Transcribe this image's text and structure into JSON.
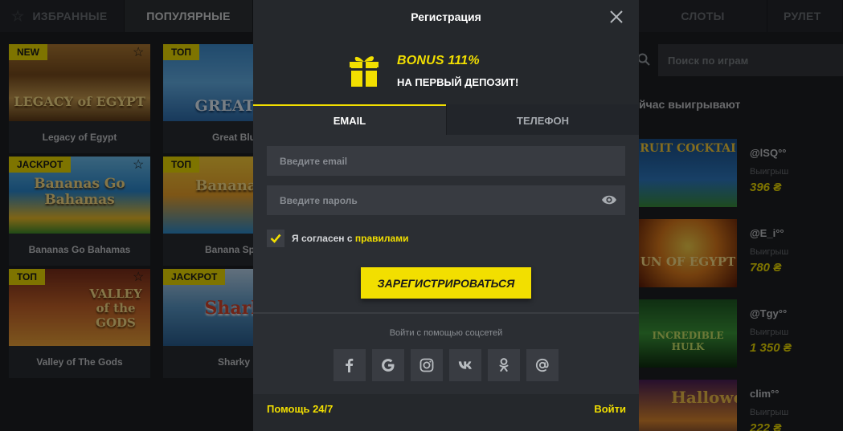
{
  "top_tabs": {
    "favorites": "ИЗБРАННЫЕ",
    "popular": "ПОПУЛЯРНЫЕ",
    "slots": "СЛОТЫ",
    "roulette": "РУЛЕТ"
  },
  "games": [
    {
      "badge": "NEW",
      "name": "Legacy of Egypt",
      "art": "LEGACY of EGYPT"
    },
    {
      "badge": "ТОП",
      "name": "Great Blu",
      "art": "GREAT B"
    },
    {
      "badge": "JACKPOT",
      "name": "Bananas Go Bahamas",
      "art": "Bananas Go Bahamas"
    },
    {
      "badge": "ТОП",
      "name": "Banana Spla",
      "art": "Banana S"
    },
    {
      "badge": "ТОП",
      "name": "Valley of The Gods",
      "art": "VALLEY of the GODS"
    },
    {
      "badge": "JACKPOT",
      "name": "Sharky",
      "art": "Shark"
    }
  ],
  "search": {
    "placeholder": "Поиск по играм"
  },
  "now_winning": {
    "title": "йчас выигрывают",
    "items": [
      {
        "user": "@lSQ°°",
        "label": "Выигрыш",
        "amount": "396 ₴",
        "art": "RUIT COCKTAI"
      },
      {
        "user": "@E_i°°",
        "label": "Выигрыш",
        "amount": "780 ₴",
        "art": "UN OF EGYPT"
      },
      {
        "user": "@Tgy°°",
        "label": "Выигрыш",
        "amount": "1 350 ₴",
        "art": "INCREDIBLE HULK"
      },
      {
        "user": "clim°°",
        "label": "Выигрыш",
        "amount": "222 ₴",
        "art": "Hallowe"
      }
    ]
  },
  "modal": {
    "title": "Регистрация",
    "bonus_title": "BONUS 111%",
    "bonus_sub": "НА ПЕРВЫЙ ДЕПОЗИТ!",
    "tabs": {
      "email": "EMAIL",
      "phone": "ТЕЛЕФОН"
    },
    "email_placeholder": "Введите email",
    "password_placeholder": "Введите пароль",
    "agree_text": "Я согласен с ",
    "agree_link": "правилами",
    "agree_checked": true,
    "register_button": "ЗАРЕГИСТРИРОВАТЬСЯ",
    "social_title": "Войти с помощью соцсетей",
    "socials": [
      "facebook-icon",
      "google-icon",
      "instagram-icon",
      "vk-icon",
      "odnoklassniki-icon",
      "mail-at-icon"
    ],
    "help": "Помощь 24/7",
    "login": "Войти"
  },
  "colors": {
    "accent": "#f2df00",
    "modal_bg": "#2b2e33",
    "page_bg": "#1d1f23"
  }
}
